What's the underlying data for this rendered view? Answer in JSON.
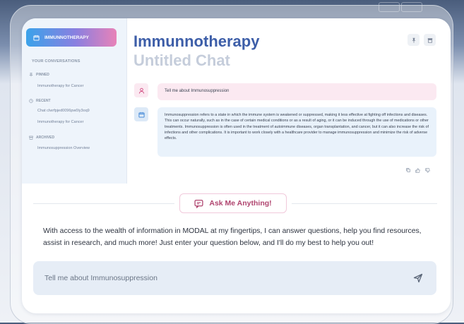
{
  "sidebar": {
    "brand_label": "IMMUNNOTHERAPY",
    "heading": "YOUR CONVERSATIONS",
    "pinned": {
      "label": "PINNED",
      "items": [
        "Immunotherapy for Cancer"
      ]
    },
    "recent": {
      "label": "RECENT",
      "items": [
        "Chat cIwrfpjed0096pw0ly3oq9",
        "Immunotherapy for Cancer"
      ]
    },
    "archived": {
      "label": "ARCHIVED",
      "items": [
        "Immunosuppression Overview"
      ]
    }
  },
  "header": {
    "title": "Immunnotherapy",
    "subtitle": "Untitled Chat",
    "pin_icon": "pin-icon",
    "archive_icon": "archive-icon"
  },
  "messages": {
    "user": "Tell me about Immunosuppression",
    "assistant": "Immunosuppression refers to a state in which the immune system is weakened or suppressed, making it less effective at fighting off infections and diseases. This can occur naturally, such as in the case of certain medical conditions or as a result of aging, or it can be induced through the use of medications or other treatments. Immunosuppression is often used in the treatment of autoimmune diseases, organ transplantation, and cancer, but it can also increase the risk of infections and other complications. It is important to work closely with a healthcare provider to manage immunosuppression and minimize the risk of adverse effects."
  },
  "ask": {
    "label": "Ask Me Anything!",
    "description": "With access to the wealth of information in MODAL at my fingertips, I can answer questions, help you find resources, assist in research, and much more! Just enter your question below, and I'll do my best to help you out!"
  },
  "input": {
    "placeholder": "Tell me about Immunosuppression"
  },
  "colors": {
    "accent_blue": "#3d5ea8",
    "accent_pink": "#b0456f",
    "user_bubble": "#fbe9f1",
    "bot_bubble": "#e9f2fb"
  }
}
